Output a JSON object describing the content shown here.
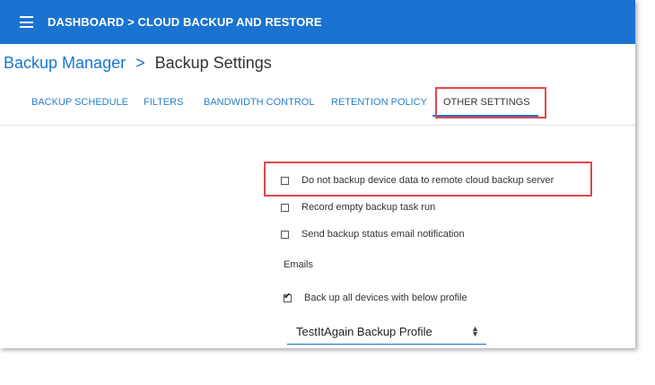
{
  "topbar": {
    "title": "DASHBOARD > CLOUD BACKUP AND RESTORE",
    "menu_icon": "hamburger-icon"
  },
  "breadcrumb": {
    "root": "Backup Manager",
    "separator": ">",
    "current": "Backup Settings"
  },
  "tabs": [
    {
      "label": "BACKUP SCHEDULE",
      "active": false
    },
    {
      "label": "FILTERS",
      "active": false
    },
    {
      "label": "BANDWIDTH CONTROL",
      "active": false
    },
    {
      "label": "RETENTION POLICY",
      "active": false
    },
    {
      "label": "OTHER SETTINGS",
      "active": true
    }
  ],
  "options": [
    {
      "label": "Do not backup device data to remote cloud backup server",
      "checked": false
    },
    {
      "label": "Record empty backup task run",
      "checked": false
    },
    {
      "label": "Send backup status email notification",
      "checked": false
    }
  ],
  "emails_label": "Emails",
  "profile_option": {
    "label": "Back up all devices with below profile",
    "checked": true
  },
  "profile_select": {
    "value": "TestItAgain Backup Profile"
  },
  "colors": {
    "topbar": "#1a73d1",
    "accent": "#1a73d1",
    "highlight": "#e0474c"
  }
}
